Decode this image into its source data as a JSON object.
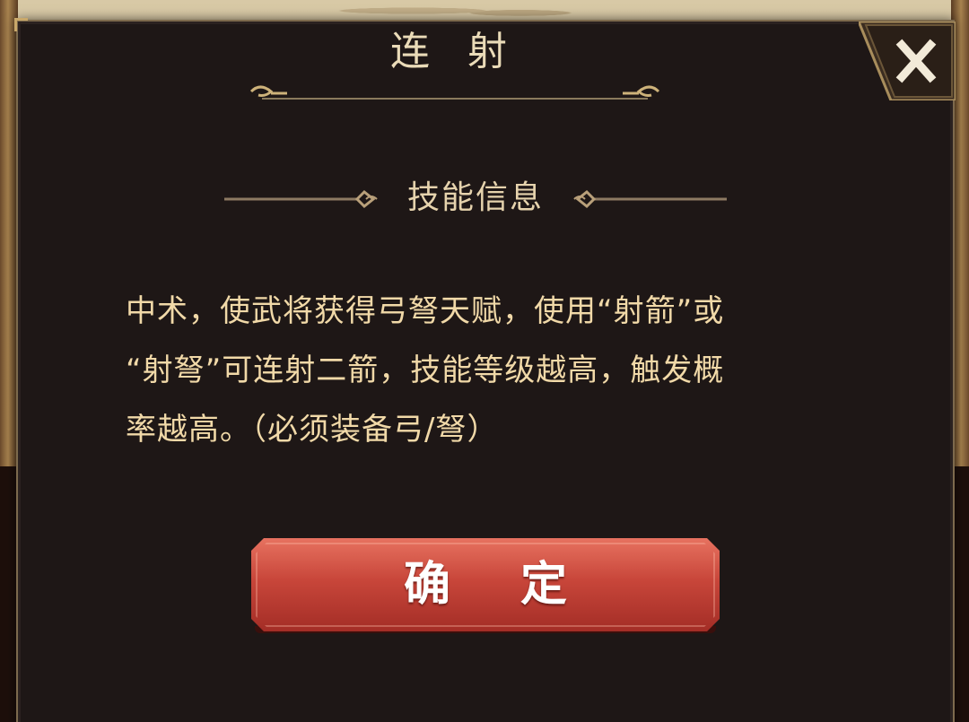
{
  "dialog": {
    "title": "连 射",
    "close_icon": "close-x-icon",
    "section_title": "技能信息",
    "description": "中术，使武将获得弓弩天赋，使用“射箭”或\n“射弩”可连射二箭，技能等级越高，触发概\n率越高。（必须装备弓/弩）",
    "confirm_label": "确 定"
  },
  "colors": {
    "dialog_bg": "#1e1716",
    "frame_gold": "#7d6a4d",
    "title_text": "#eadbb8",
    "desc_text": "#f1d9a8",
    "button_red": "#c8463a"
  }
}
